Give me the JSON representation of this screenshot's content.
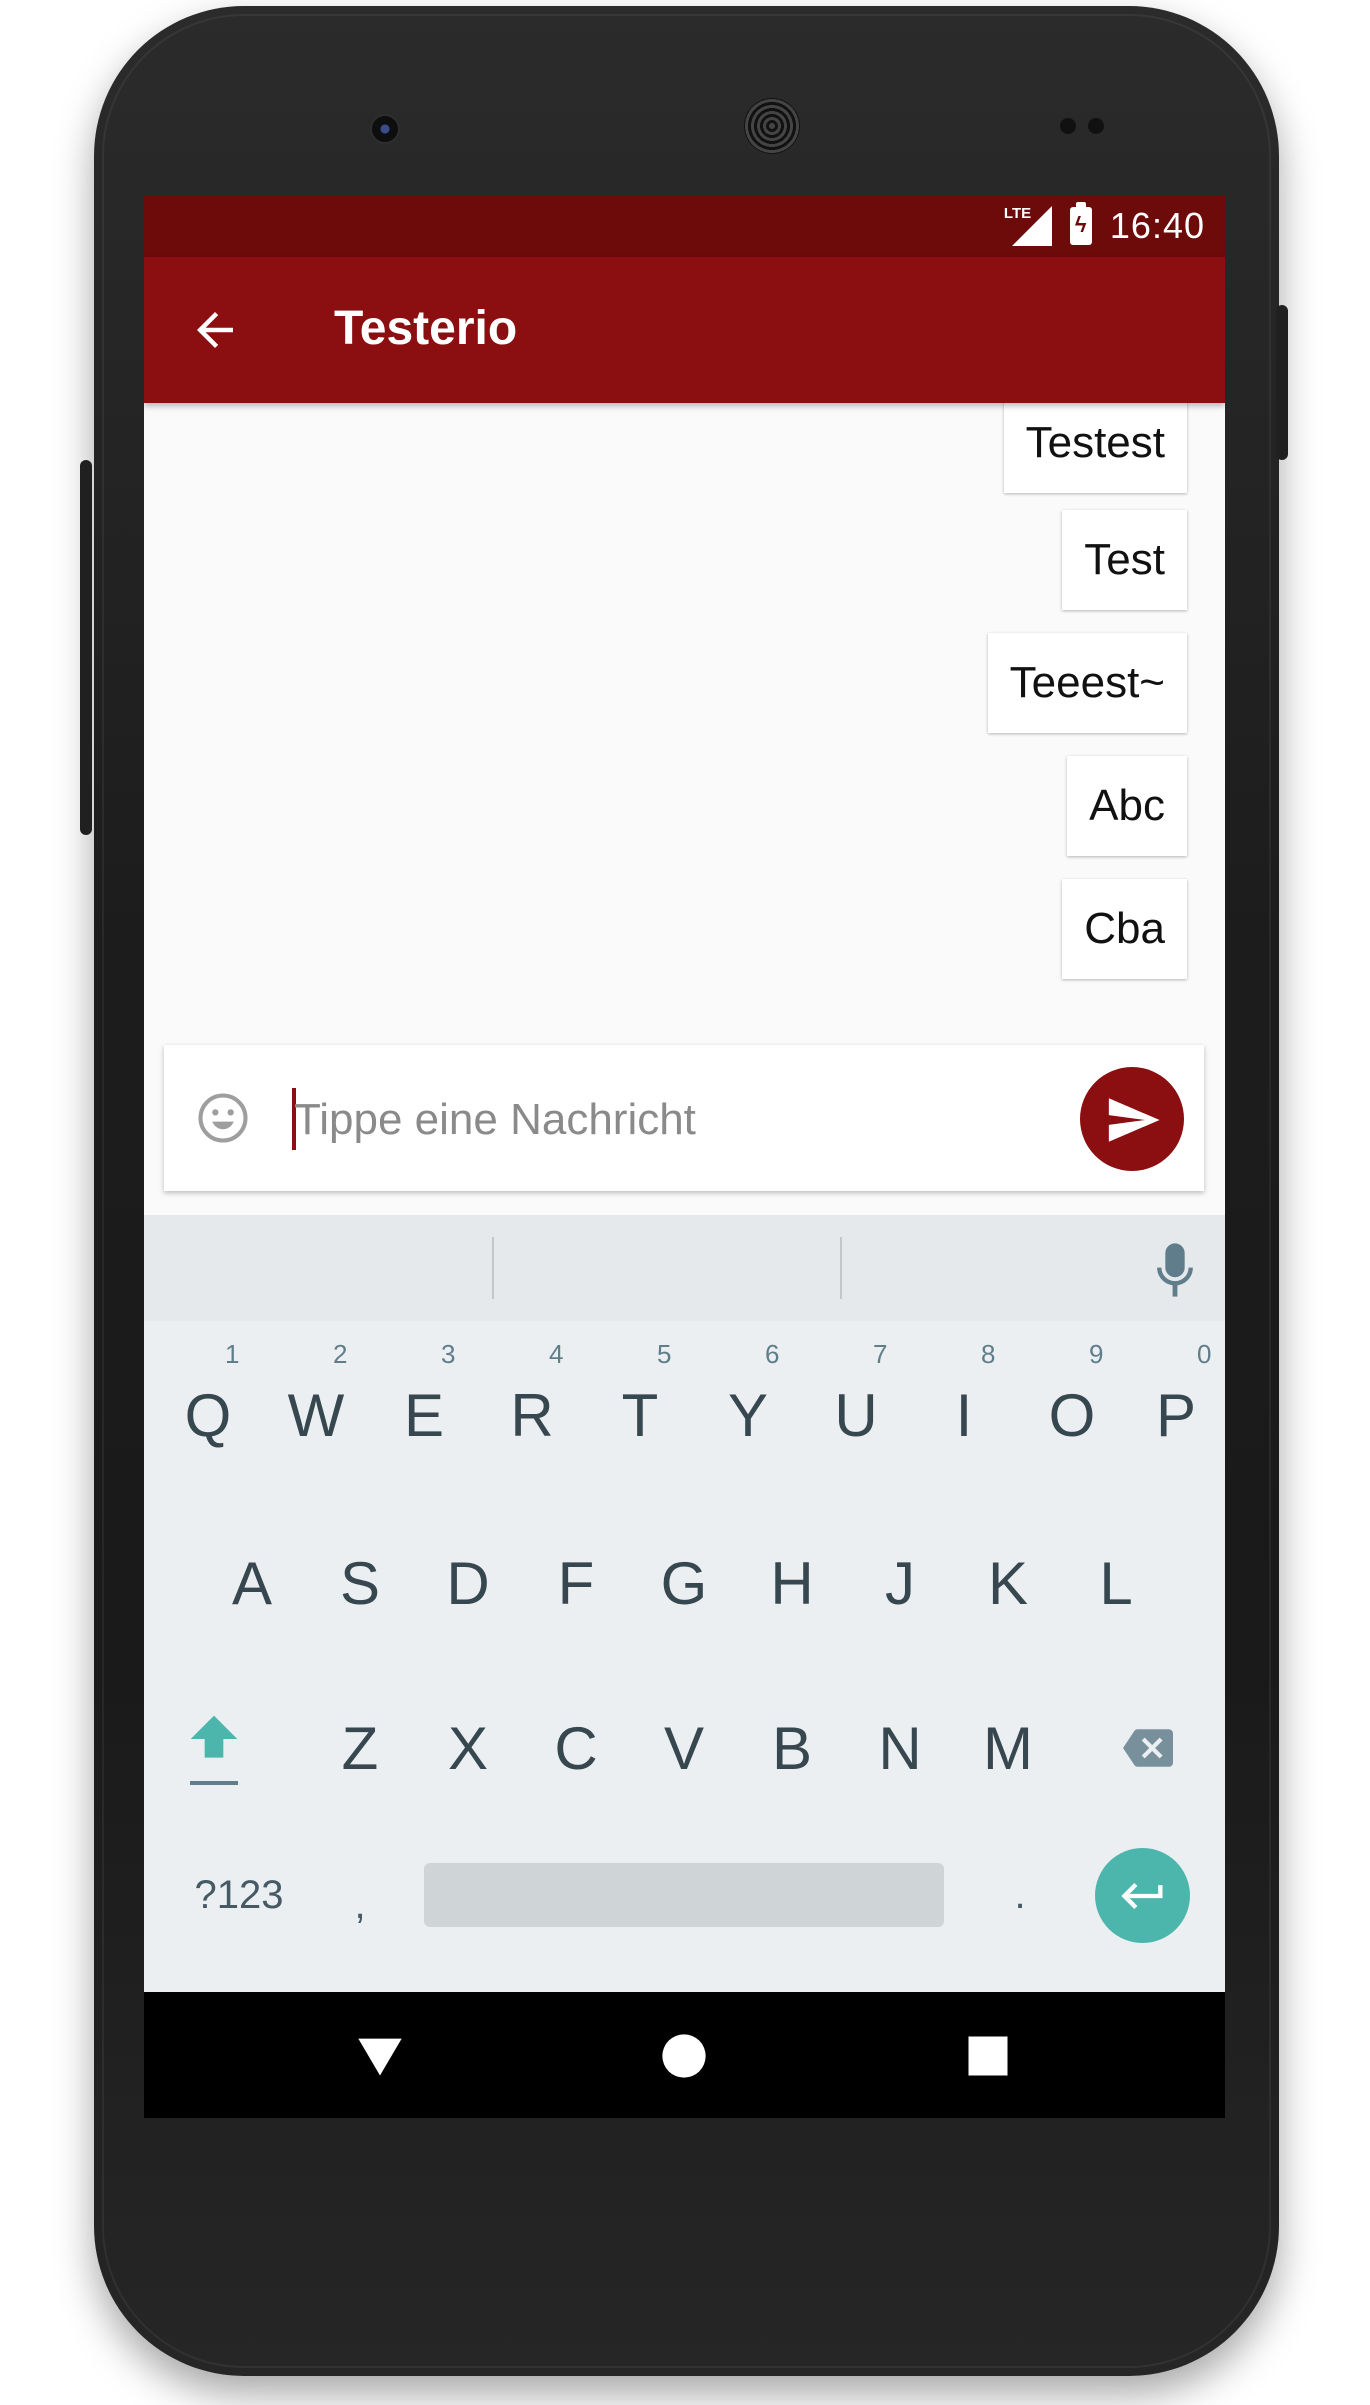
{
  "status_bar": {
    "network_label": "LTE",
    "time": "16:40"
  },
  "app_bar": {
    "title": "Testerio",
    "back_icon": "arrow-back-icon"
  },
  "messages": [
    "Testest",
    "Test",
    "Teeest~",
    "Abc",
    "Cba"
  ],
  "composer": {
    "placeholder": "Tippe eine Nachricht",
    "emoji_icon": "emoji-icon",
    "send_icon": "send-icon"
  },
  "keyboard": {
    "row1": [
      "Q",
      "W",
      "E",
      "R",
      "T",
      "Y",
      "U",
      "I",
      "O",
      "P"
    ],
    "row1_hints": [
      "1",
      "2",
      "3",
      "4",
      "5",
      "6",
      "7",
      "8",
      "9",
      "0"
    ],
    "row2": [
      "A",
      "S",
      "D",
      "F",
      "G",
      "H",
      "J",
      "K",
      "L"
    ],
    "row3": [
      "Z",
      "X",
      "C",
      "V",
      "B",
      "N",
      "M"
    ],
    "symbols_label": "?123",
    "comma": ",",
    "period": ".",
    "colors": {
      "enter": "#4db6ac",
      "shift": "#4db6ac",
      "key_text": "#37474f"
    }
  },
  "colors": {
    "primary": "#8b0e10",
    "primary_dark": "#6d0b0b"
  },
  "nav_bar": {
    "icons": [
      "back-triangle-icon",
      "home-circle-icon",
      "recents-square-icon"
    ]
  }
}
